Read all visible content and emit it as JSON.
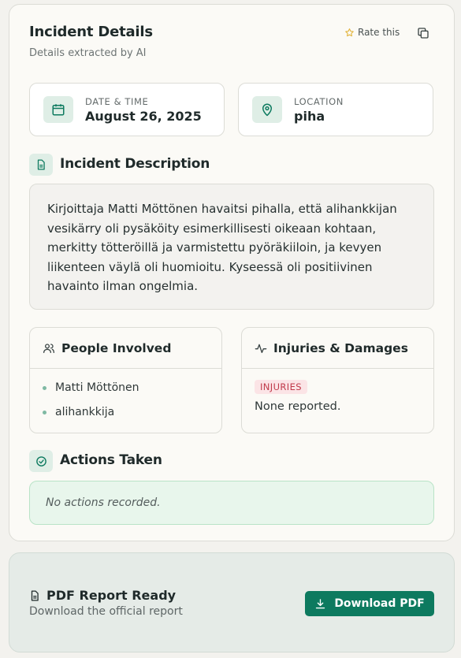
{
  "header": {
    "title": "Incident Details",
    "subtitle": "Details extracted by AI",
    "rate_label": "Rate this"
  },
  "date_time": {
    "label": "DATE & TIME",
    "value": "August 26, 2025"
  },
  "location": {
    "label": "LOCATION",
    "value": "piha"
  },
  "description": {
    "title": "Incident Description",
    "text": "Kirjoittaja Matti Möttönen havaitsi pihalla, että alihankkijan vesikärry oli pysäköity esimerkillisesti oikeaan kohtaan, merkitty tötteröillä ja varmistettu pyöräkiiloin, ja kevyen liikenteen väylä oli huomioitu. Kyseessä oli positiivinen havainto ilman ongelmia."
  },
  "people": {
    "title": "People Involved",
    "items": [
      "Matti Möttönen",
      "alihankkija"
    ]
  },
  "injuries": {
    "title": "Injuries & Damages",
    "badge": "INJURIES",
    "value": "None reported."
  },
  "actions": {
    "title": "Actions Taken",
    "empty_text": "No actions recorded."
  },
  "pdf": {
    "title": "PDF Report Ready",
    "subtitle": "Download the official report",
    "button_label": "Download PDF"
  },
  "colors": {
    "accent": "#0d7a5f",
    "icon_bg": "#dfeee6",
    "injury_badge": "#c0394a",
    "actions_bg": "#e8f6ec"
  }
}
